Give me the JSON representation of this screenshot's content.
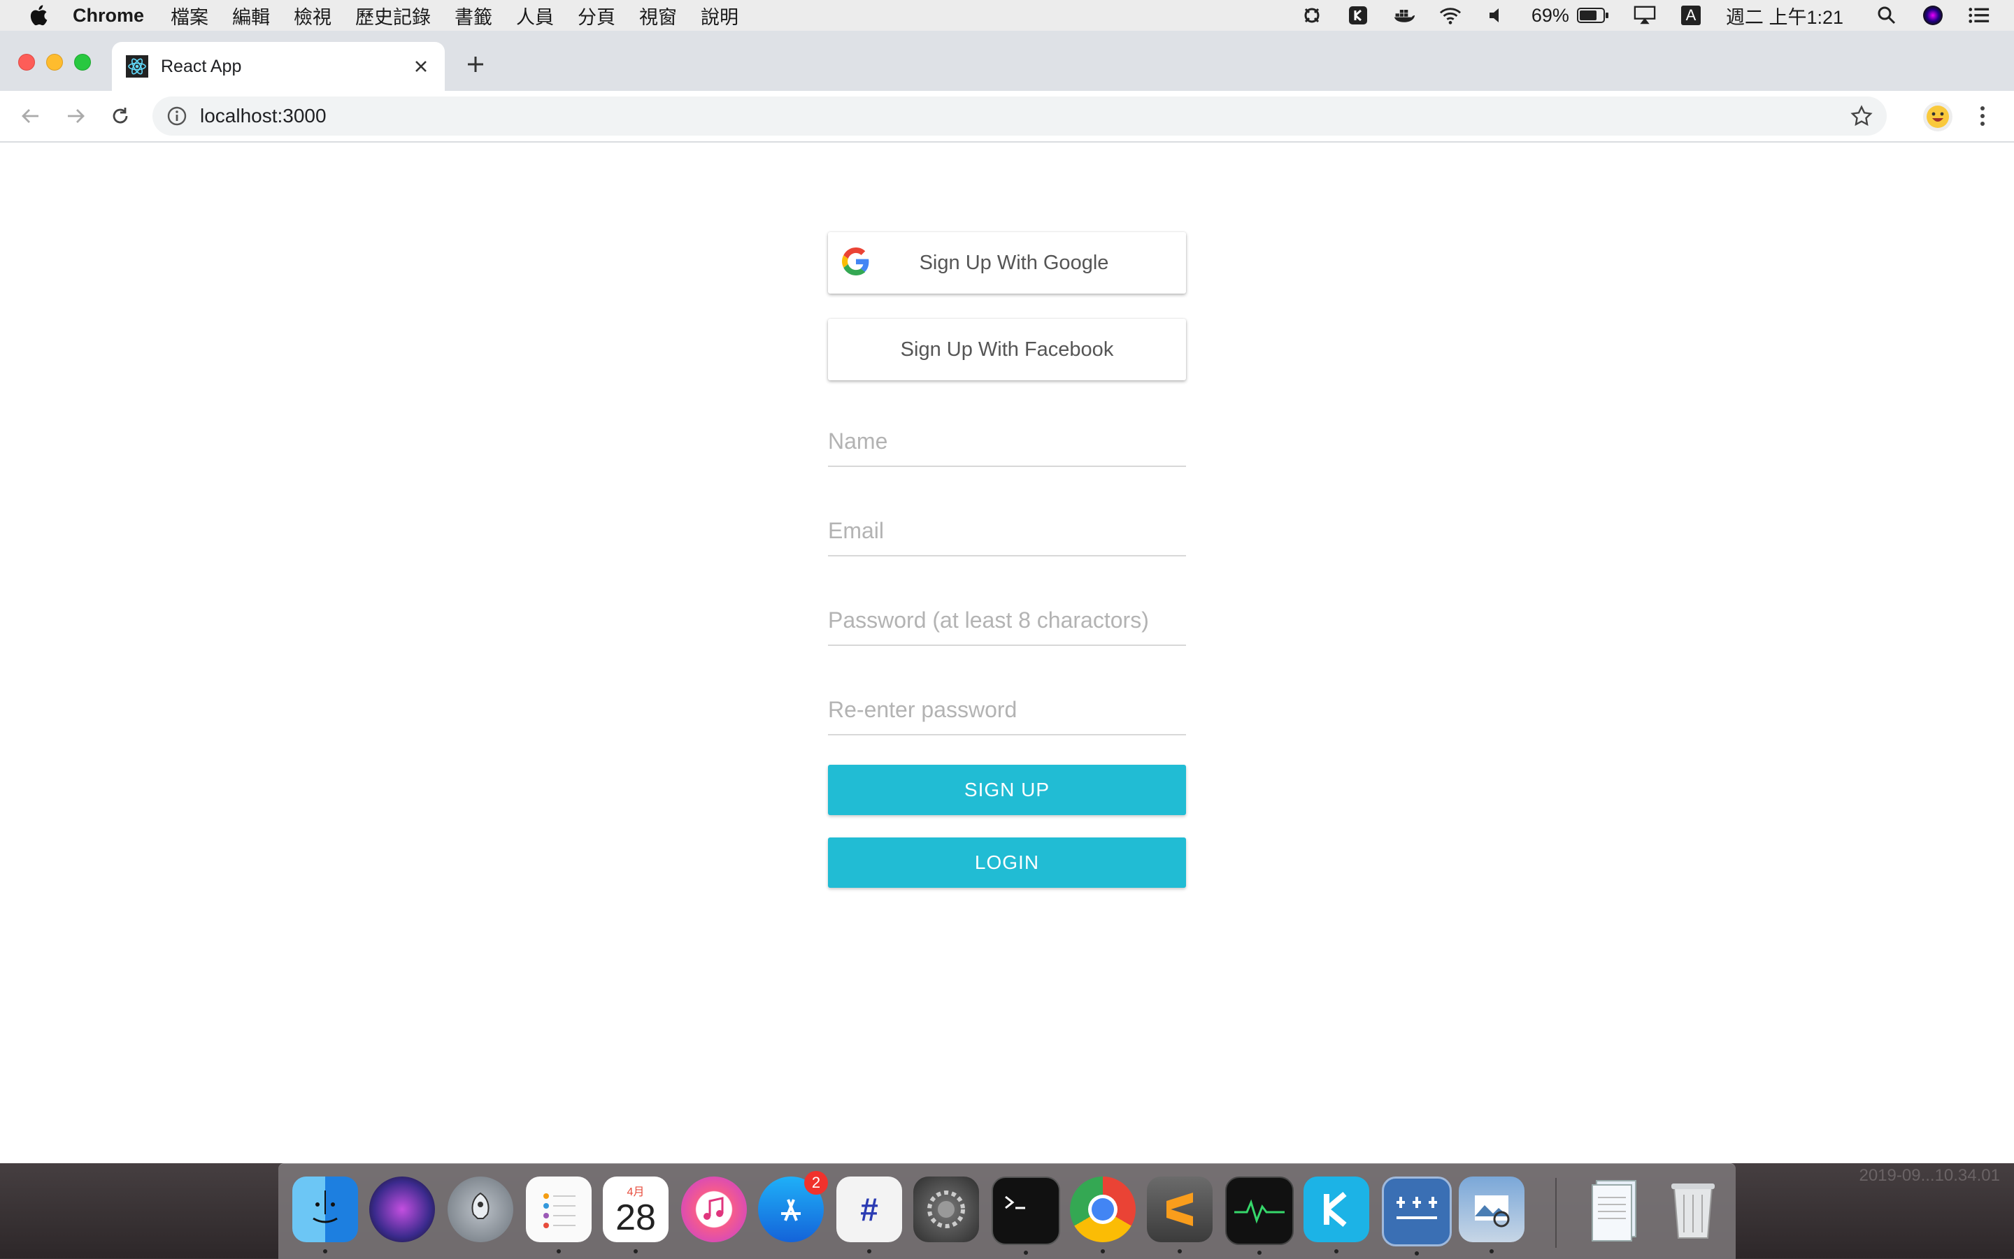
{
  "menubar": {
    "app_name": "Chrome",
    "items": [
      "檔案",
      "編輯",
      "檢視",
      "歷史記錄",
      "書籤",
      "人員",
      "分頁",
      "視窗",
      "說明"
    ],
    "battery": "69%",
    "datetime": "週二 上午1:21",
    "input_method": "A"
  },
  "browser": {
    "tab_title": "React App",
    "url": "localhost:3000"
  },
  "signup_form": {
    "google_button": "Sign Up With Google",
    "facebook_button": "Sign Up With Facebook",
    "name_placeholder": "Name",
    "email_placeholder": "Email",
    "password_placeholder": "Password (at least 8 charactors)",
    "reenter_placeholder": "Re-enter password",
    "signup_button": "SIGN UP",
    "login_button": "LOGIN"
  },
  "dock": {
    "calendar_month": "4月",
    "calendar_day": "28",
    "appstore_badge": "2",
    "slack_label": "#"
  },
  "desktop": {
    "screenshot_label": "2019-09...10.34.01"
  },
  "colors": {
    "accent": "#21bcd4",
    "tab_strip": "#dee1e6"
  }
}
